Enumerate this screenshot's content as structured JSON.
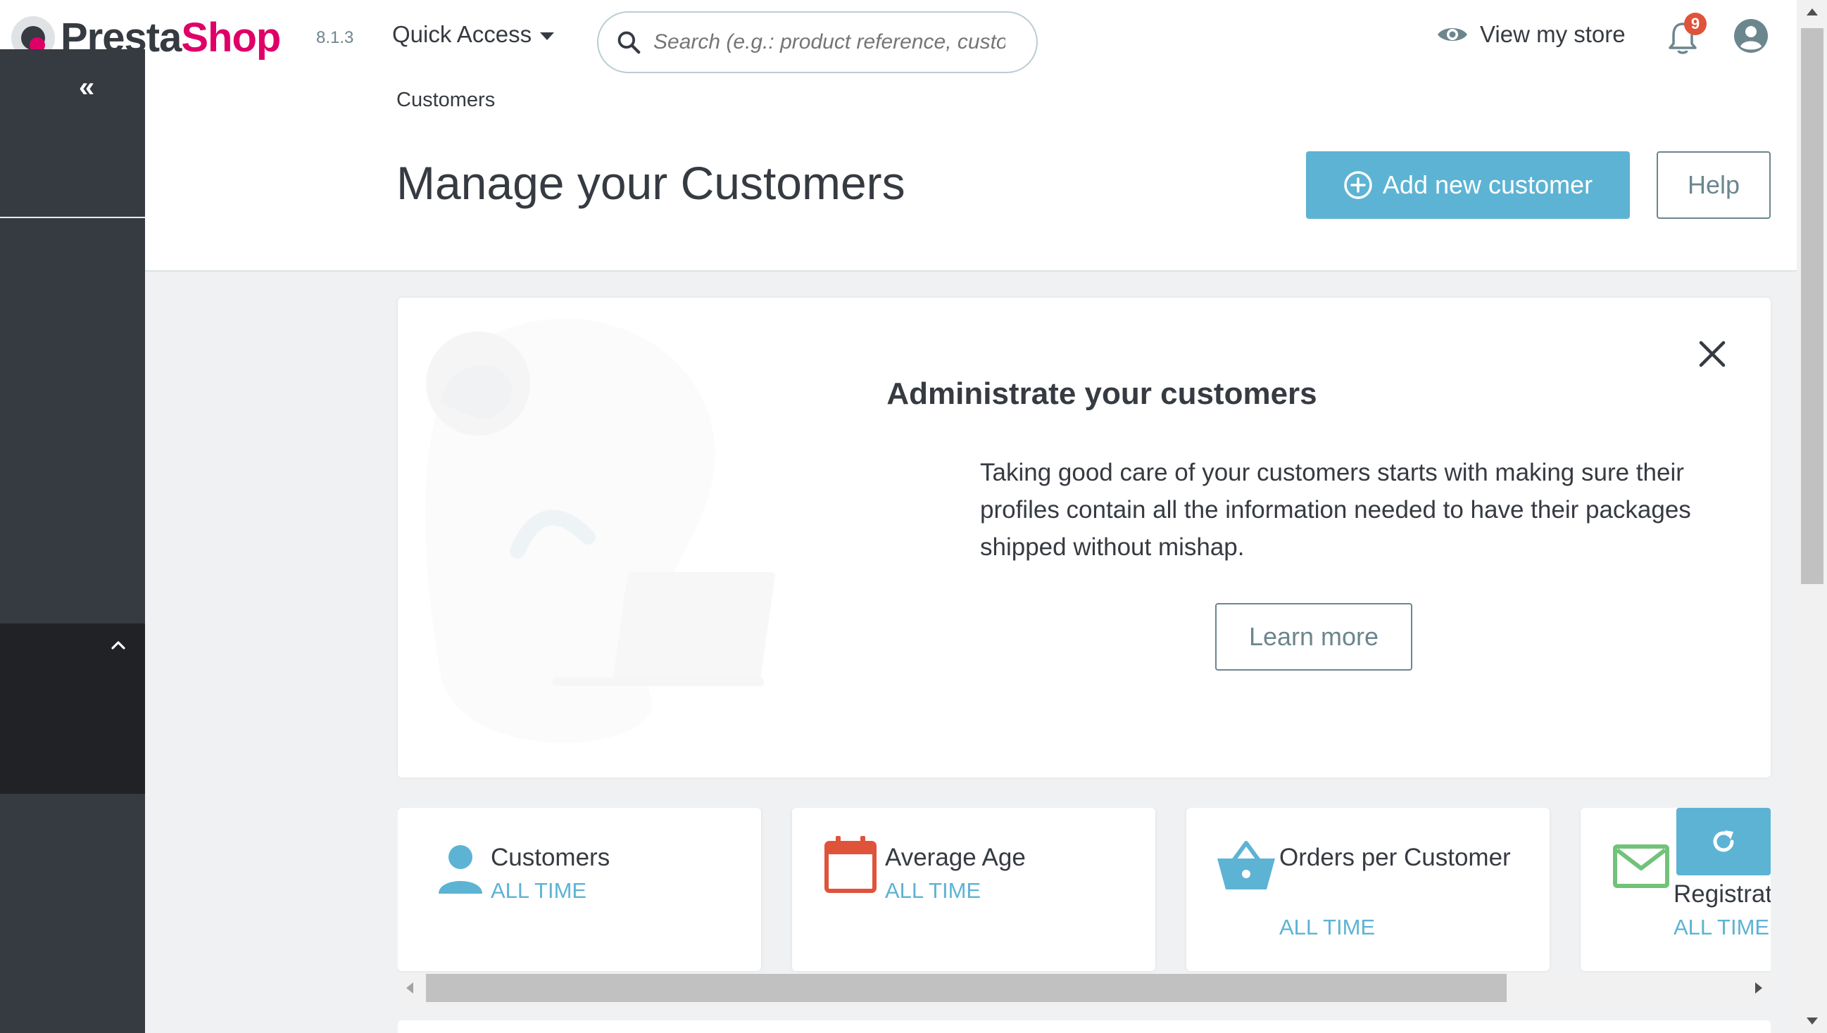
{
  "header": {
    "logo_text_part1": "Presta",
    "logo_text_part2": "Shop",
    "version": "8.1.3",
    "quick_access_label": "Quick Access",
    "search_placeholder": "Search (e.g.: product reference, custon",
    "view_store_label": "View my store",
    "notification_count": "9",
    "icons": [
      "search-icon",
      "eye-icon",
      "bell-icon",
      "account-icon",
      "chevron-down-icon"
    ]
  },
  "sidebar": {
    "collapse_label": "«",
    "icons": [
      "collapse-icon",
      "chevron-up-icon"
    ]
  },
  "page": {
    "breadcrumb": "Customers",
    "title": "Manage your Customers",
    "add_button_label": "Add new customer",
    "help_button_label": "Help"
  },
  "promo": {
    "title": "Administrate your customers",
    "text": "Taking good care of your customers starts with making sure their profiles contain all the information needed to have their packages shipped without mishap.",
    "learn_more_label": "Learn more"
  },
  "kpis": [
    {
      "name": "Customers",
      "period": "ALL TIME",
      "icon": "user-icon",
      "color": "#5db3d4"
    },
    {
      "name": "Average Age",
      "period": "ALL TIME",
      "icon": "calendar-icon",
      "color": "#e0533b"
    },
    {
      "name": "Orders per Customer",
      "period": "ALL TIME",
      "icon": "basket-icon",
      "color": "#5db3d4"
    },
    {
      "name": "Registrat",
      "period": "ALL TIME",
      "icon": "envelope-icon",
      "color": "#72c279"
    }
  ],
  "colors": {
    "accent": "#5db3d4",
    "brand_pink": "#df0067",
    "sidebar": "#363a41",
    "sidebar_active": "#202226",
    "danger": "#e0533b",
    "success": "#72c279"
  }
}
